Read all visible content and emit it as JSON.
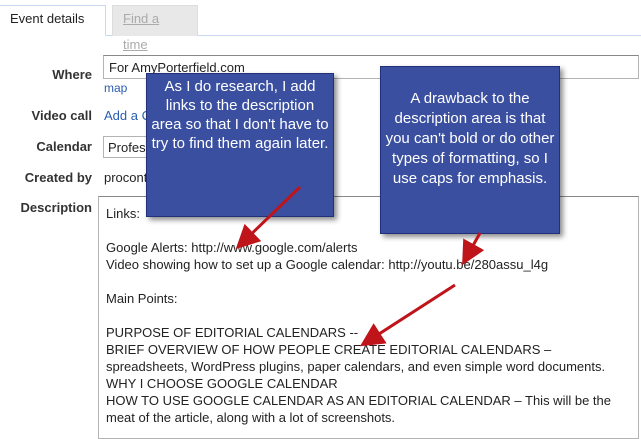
{
  "tabs": {
    "event_details": "Event details",
    "find_time": "Find a time"
  },
  "labels": {
    "where": "Where",
    "video_call": "Video call",
    "calendar": "Calendar",
    "created_by": "Created by",
    "description": "Description"
  },
  "where_value": "For AmyPorterfield.com",
  "map_link": "map",
  "video_call_link": "Add a C",
  "calendar_value": "Profes",
  "created_by_value": "proconto",
  "description_text": "Links:\n\nGoogle Alerts: http://www.google.com/alerts\nVideo showing how to set up a Google calendar: http://youtu.be/280assu_l4g\n\nMain Points:\n\nPURPOSE OF EDITORIAL CALENDARS --\nBRIEF OVERVIEW OF HOW PEOPLE CREATE EDITORIAL CALENDARS –\nspreadsheets, WordPress plugins, paper calendars, and even simple word documents.\nWHY I CHOOSE GOOGLE CALENDAR\nHOW TO USE GOOGLE CALENDAR AS AN EDITORIAL CALENDAR – This will be the\nmeat of the article, along with a lot of screenshots.",
  "callouts": {
    "research": "As I do research, I add links to the description area so that I don't have to try to find them again later.",
    "drawback": "A drawback to the description area is that you can't bold or do other types of formatting, so I use caps for emphasis."
  },
  "colors": {
    "callout_bg": "#3a4fa0",
    "arrow": "#c0141b",
    "link": "#2a5db0"
  }
}
